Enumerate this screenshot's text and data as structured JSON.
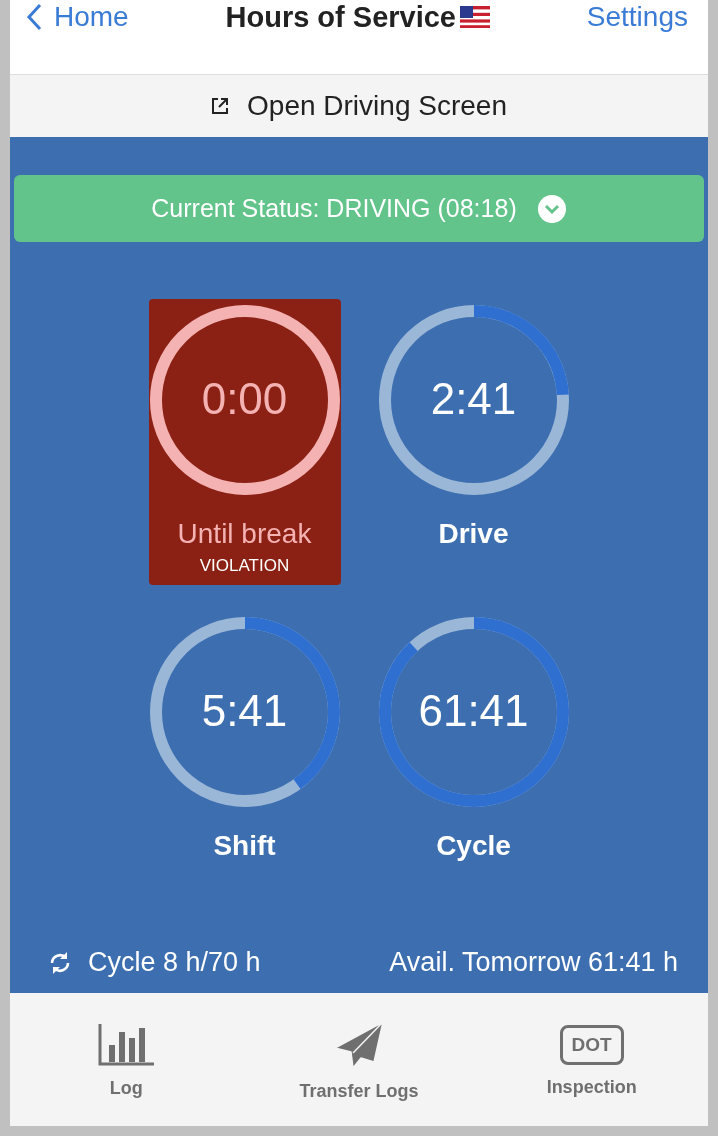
{
  "nav": {
    "back": "Home",
    "title": "Hours of Service",
    "action": "Settings"
  },
  "open_driving": "Open Driving Screen",
  "status": {
    "label": "Current Status: DRIVING (08:18)"
  },
  "gauges": [
    {
      "kind": "violation",
      "value": "0:00",
      "label": "Until break",
      "note": "VIOLATION"
    },
    {
      "kind": "normal",
      "value": "2:41",
      "label": "Drive"
    },
    {
      "kind": "normal",
      "value": "5:41",
      "label": "Shift"
    },
    {
      "kind": "normal",
      "value": "61:41",
      "label": "Cycle"
    }
  ],
  "summary": {
    "cycle": "Cycle 8 h/70 h",
    "avail": "Avail. Tomorrow 61:41 h"
  },
  "tabs": [
    {
      "kind": "log",
      "label": "Log"
    },
    {
      "kind": "transfer",
      "label": "Transfer Logs"
    },
    {
      "kind": "dot",
      "label": "Inspection",
      "icon_text": "DOT"
    }
  ]
}
